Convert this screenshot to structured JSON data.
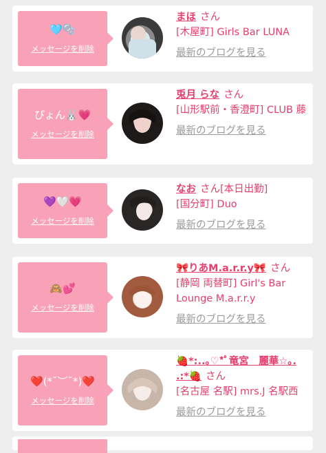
{
  "delete_label": "メッセージを削除",
  "blog_label": "最新のブログを見る",
  "honorific": "さん",
  "cards": [
    {
      "message": "🩵🫧",
      "name": "まほ",
      "extra": "",
      "shop": "[木屋町] Girls Bar LUNA"
    },
    {
      "message": "ぴょん🐰💗",
      "name": "兎月 らな",
      "extra": "",
      "shop": "[山形駅前・香澄町] CLUB 藤"
    },
    {
      "message": "💜🤍💗",
      "name": "なお",
      "extra": "[本日出勤]",
      "shop": "[国分町] Duo"
    },
    {
      "message": "🙈💕",
      "name": "🎀りあM.a.r.r.y🎀",
      "extra": "",
      "shop": "[静岡 両替町] Girl's Bar Lounge M.a.r.r.y"
    },
    {
      "message": "❤️(*˘︶˘*)❤️",
      "name": "🍓*:..｡♡*ﾟ竜宮　麗華☆｡. .:*🍓",
      "extra": "",
      "shop": "[名古屋 名駅] mrs.J 名駅西"
    }
  ],
  "colors": {
    "accent": "#e63e6d",
    "box": "#f8a1b7",
    "muted": "#9b9b9b",
    "background": "#eeeeee"
  }
}
